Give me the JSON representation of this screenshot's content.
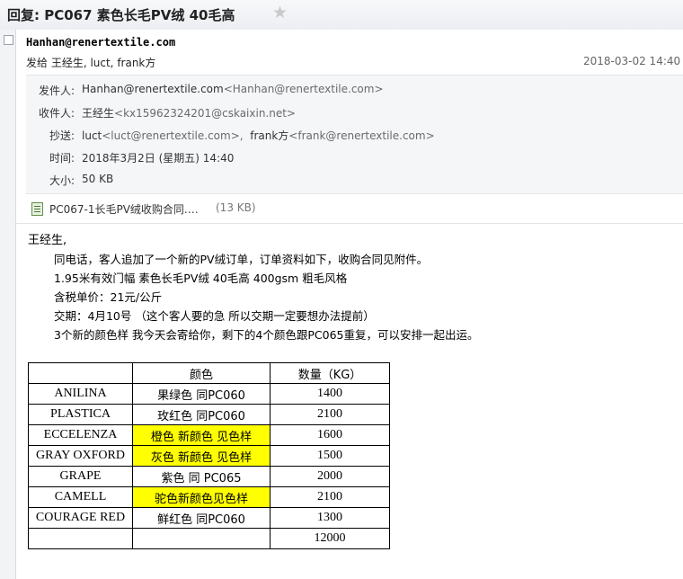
{
  "window": {
    "title": "回复: PC067  素色长毛PV绒 40毛高"
  },
  "message": {
    "sender": "Hanhan@renertextile.com",
    "sendto": "发给 王经生, luct, frank方",
    "date": "2018-03-02 14:40",
    "headers": [
      {
        "label": "发件人:",
        "name": "Hanhan@renertextile.com",
        "addr": "<Hanhan@renertextile.com>"
      },
      {
        "label": "收件人:",
        "name": "王经生",
        "addr": "<kx15962324201@cskaixin.net>"
      },
      {
        "label": "抄送:",
        "name": "luct",
        "addr": "<luct@renertextile.com>,",
        "name2": "frank方",
        "addr2": "<frank@renertextile.com>"
      },
      {
        "label": "时间:",
        "name": "2018年3月2日 (星期五) 14:40",
        "addr": ""
      },
      {
        "label": "大小:",
        "name": "50 KB",
        "addr": ""
      }
    ],
    "attachment": {
      "name": "PC067-1长毛PV绒收购合同.…",
      "size": "(13 KB)",
      "icon": "excel-file-icon"
    },
    "body": {
      "greeting": "王经生,",
      "lines": [
        "同电话，客人追加了一个新的PV绒订单，订单资料如下，收购合同见附件。",
        "1.95米有效门幅  素色长毛PV绒 40毛高 400gsm 粗毛风格",
        "含税单价：21元/公斤",
        "交期：4月10号 （这个客人要的急  所以交期一定要想办法提前）",
        "3个新的颜色样 我今天会寄给你，剩下的4个颜色跟PC065重复，可以安排一起出运。"
      ]
    },
    "table": {
      "headers": [
        "",
        "颜色",
        "数量（KG）"
      ],
      "rows": [
        {
          "name": "ANILINA",
          "color": "果绿色 同PC060",
          "qty": "1400",
          "highlight": false
        },
        {
          "name": "PLASTICA",
          "color": "玫红色 同PC060",
          "qty": "2100",
          "highlight": false
        },
        {
          "name": "ECCELENZA",
          "color": "橙色 新颜色 见色样",
          "qty": "1600",
          "highlight": true
        },
        {
          "name": "GRAY OXFORD",
          "color": "灰色 新颜色 见色样",
          "qty": "1500",
          "highlight": true
        },
        {
          "name": "GRAPE",
          "color": "紫色 同 PC065",
          "qty": "2000",
          "highlight": false
        },
        {
          "name": "CAMELL",
          "color": "驼色新颜色见色样",
          "qty": "2100",
          "highlight": true
        },
        {
          "name": "COURAGE RED",
          "color": "鲜红色 同PC060",
          "qty": "1300",
          "highlight": false
        },
        {
          "name": "",
          "color": "",
          "qty": "12000",
          "highlight": false
        }
      ],
      "highlight_color": "#ffff00"
    }
  }
}
